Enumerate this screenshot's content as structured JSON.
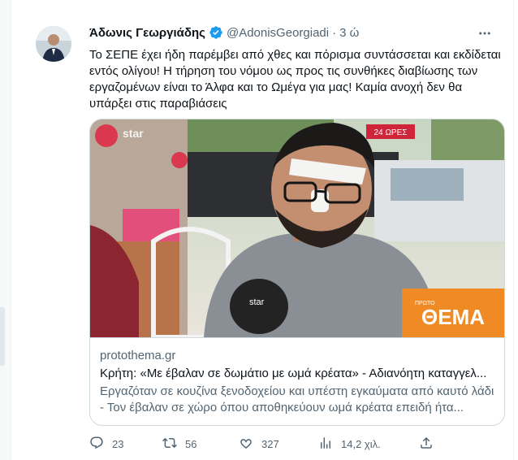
{
  "tweet": {
    "author_name": "Άδωνις Γεωργιάδης",
    "handle": "@AdonisGeorgiadi",
    "separator": "·",
    "time": "3 ώ",
    "text": "Το ΣΕΠΕ έχει ήδη παρέμβει από χθες και πόρισμα συντάσσεται και εκδίδεται εντός ολίγου! Η τήρηση του νόμου ως προς τις συνθήκες διαβίωσης των εργαζομένων είναι το Άλφα και το Ωμέγα για μας! Καμία ανοχή δεν θα υπάρξει στις παραβιάσεις",
    "card": {
      "domain": "protothema.gr",
      "title": "Κρήτη: «Με έβαλαν σε δωμάτιο με ωμά κρέατα» - Αδιανόητη καταγγελ...",
      "description": "Εργαζόταν σε κουζίνα ξενοδοχείου και υπέστη εγκαύματα από καυτό λάδι - Τον έβαλαν σε χώρο όπου αποθηκεύουν ωμά κρέατα επειδή ήτα...",
      "image_logo_top": "ΠΡΩΤΟ",
      "image_logo_main": "ΘΕΜΑ",
      "image_watermark": "star",
      "image_sign": "24 ΩΡΕΣ"
    },
    "actions": {
      "replies": "23",
      "retweets": "56",
      "likes": "327",
      "views": "14,2 χιλ."
    }
  },
  "colors": {
    "verified": "#1d9bf0",
    "secondary_text": "#536471",
    "border": "#cfd9de",
    "logo_orange": "#f08a24"
  },
  "icons": [
    "verified-badge-icon",
    "more-icon",
    "reply-icon",
    "retweet-icon",
    "like-icon",
    "views-icon",
    "share-icon"
  ]
}
